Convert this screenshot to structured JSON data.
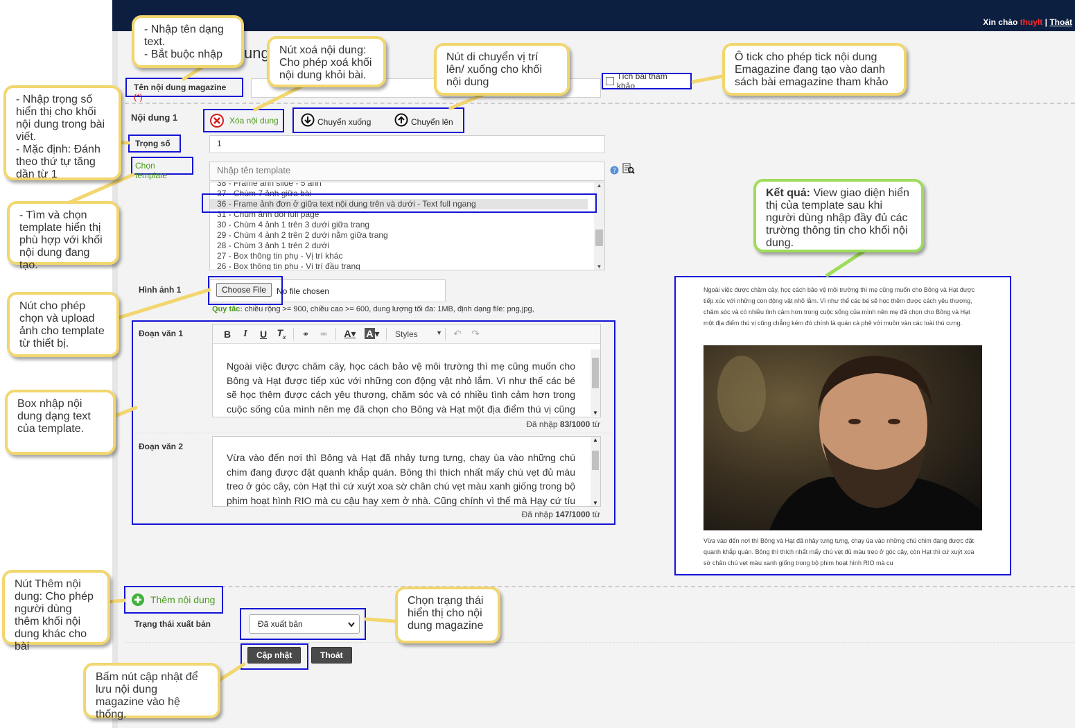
{
  "header": {
    "greeting": "Xin chào",
    "username": "thuylt",
    "sep": " | ",
    "logout": "Thoát"
  },
  "form": {
    "title_partial": "ung",
    "magazine_name_label": "Tên nội dung magazine",
    "required_mark": "(*)",
    "reference_checkbox_label": "Tích bài tham khảo",
    "section_label": "Nội dung 1",
    "delete_button": "Xóa nội dung",
    "move_down": "Chuyển xuống",
    "move_up": "Chuyển lên",
    "weight_label": "Trọng số",
    "weight_value": "1",
    "template_label": "Chọn template",
    "template_search_placeholder": "Nhập tên template",
    "template_list": [
      "38 - Frame ảnh slide - 5 ảnh",
      "37 - Chùm 7 ảnh giữa bài",
      "36 - Frame ảnh đơn ở giữa text nội dung trên và dưới - Text full ngang",
      "31 - Chùm ảnh đôi full page",
      "30 - Chùm 4 ảnh 1 trên 3 dưới giữa trang",
      "29 - Chùm 4 ảnh 2 trên 2 dưới nằm giữa trang",
      "28 - Chùm 3 ảnh 1 trên 2 dưới",
      "27 - Box thông tin phụ - Vị trí khác",
      "26 - Box thông tin phụ - Vị trí đầu trang"
    ],
    "image_label": "Hình ảnh 1",
    "choose_file": "Choose File",
    "no_file": "No file chosen",
    "rule_prefix": "Quy tắc:",
    "rule_text": " chiều rộng >= 900, chiều cao >= 600, dung lượng tối đa: 1MB, định dạng file: png,jpg,",
    "para1_label": "Đoạn văn 1",
    "para1_text": "Ngoài việc được chăm cây, học cách bảo vệ môi trường thì mẹ cũng muốn cho Bông và Hạt được tiếp xúc với những con động vật nhỏ lắm. Vì như thế các bé sẽ học thêm được cách yêu thương, chăm sóc và có nhiều tình cảm hơn trong cuộc sống của mình nên mẹ đã chọn cho Bông và Hạt một địa điểm thú vị cũng chẳng kém đó chính là",
    "para1_count_prefix": "Đã nhập ",
    "para1_count": "83/1000",
    "count_suffix": " từ",
    "para2_label": "Đoạn văn 2",
    "para2_text": "Vừa vào đến nơi thì Bông và Hạt đã nhảy tưng tưng, chạy ùa vào những chú chim đang được đặt quanh khắp quán. Bông thì thích nhất mấy chú vẹt đủ màu treo ở góc cây, còn Hạt thì cứ xuýt xoa sờ chân chú vẹt màu xanh giống trong bộ phim hoạt hình RIO mà cu cậu hay xem ở nhà. Cũng chính vì thế mà Hạy cứ tíu tít chẳng chịu rời,",
    "para2_count": "147/1000",
    "styles": "Styles",
    "add_content": "Thêm nội dung",
    "status_label": "Trạng thái xuất bản",
    "status_value": "Đã xuất bản",
    "update_button": "Cập nhật",
    "exit_button": "Thoát"
  },
  "preview": {
    "text_top": "Ngoài việc được chăm cây, học cách bảo vệ môi trường thì mẹ cũng muốn cho Bông và Hạt được tiếp xúc với những con động vật nhỏ lắm. Vì như thế các bé sẽ học thêm được cách yêu thương, chăm sóc và có nhiều tình cảm hơn trong cuộc sống của mình nên mẹ đã chọn cho Bông và Hạt một địa điểm thú vị cũng chẳng kém đó chính là quán cà phê với muôn vàn các loài thú cưng.",
    "text_bottom": "Vừa vào đến nơi thì Bông và Hạt đã nhảy tưng tưng, chạy ùa vào những chú chim đang được đặt quanh khắp quán. Bông thì thích nhất mấy chú vẹt đủ màu treo ở góc cây, còn Hạt thì cứ xuýt xoa sờ chân chú vẹt màu xanh giống trong bộ phim hoạt hình RIO mà cu"
  },
  "callouts": {
    "c1": "- Nhập tên dạng text.\n- Bắt buộc nhập",
    "c2": "Nút xoá nội dung: Cho phép xoá khối nội dung khỏi bài.",
    "c3": "Nút di chuyển vị trí lên/ xuống cho khối nội dung",
    "c4": "Ô tick cho phép tick nội dung Emagazine đang tạo vào danh sách bài emagazine tham khảo",
    "c5": "- Nhập trọng số hiển thị cho khối nội dung trong bài viết.\n- Mặc định: Đánh theo thứ tự tăng dần từ 1",
    "c6": "- Tìm và chọn template hiển thị phù hợp với khối nội dung đang tạo.",
    "c7": "Nút cho phép chọn và upload ảnh cho template từ thiết bị.",
    "c8": "Box nhập nội dung dạng text của template.",
    "c9_bold": "Kết quả:",
    "c9": " View giao diện hiển thị của template sau khi người dùng nhập đầy đủ các trường thông tin cho khối nội dung.",
    "c10": "Nút Thêm nội dung: Cho phép người dùng thêm khối nội dung khác cho bài",
    "c11": "Chọn trạng thái hiển thị cho nội dung magazine",
    "c12": "Bấm nút cập nhật để lưu nội dung magazine vào hệ thống."
  },
  "colors": {
    "topbar": "#0c1f40",
    "highlight_box": "#1313d6",
    "callout_border": "#f2d66e",
    "callout_green": "#9edc5a",
    "accent_green": "#4a9a1a",
    "required_red": "#d00000"
  }
}
